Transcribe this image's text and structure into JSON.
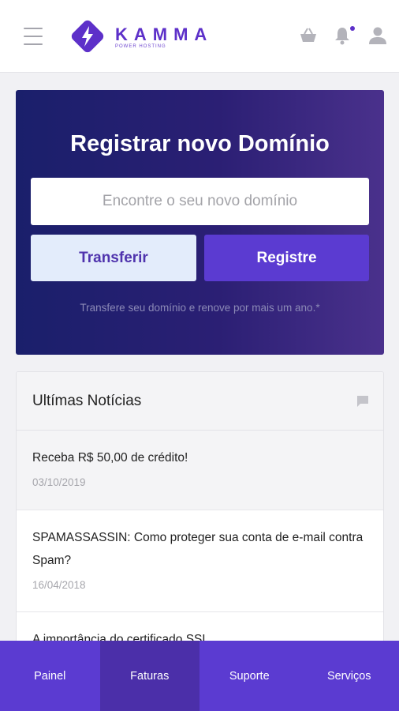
{
  "header": {
    "logo_text": "KAMMA",
    "logo_subtitle": "POWER HOSTING",
    "icons": [
      "menu-icon",
      "basket-icon",
      "bell-icon",
      "user-icon"
    ],
    "accent": "#5d30c9"
  },
  "hero": {
    "title": "Registrar novo Domínio",
    "search_placeholder": "Encontre o seu novo domínio",
    "transfer_label": "Transferir",
    "register_label": "Registre",
    "note": "Transfere seu domínio e renove por mais um ano.*"
  },
  "news": {
    "title": "Ultímas Notícias",
    "items": [
      {
        "title": "Receba R$ 50,00 de crédito!",
        "date": "03/10/2019"
      },
      {
        "title": "SPAMASSASSIN: Como proteger sua conta de e-mail contra Spam?",
        "date": "16/04/2018"
      },
      {
        "title": "A importância do certificado SSL",
        "date": ""
      }
    ]
  },
  "bottom_nav": {
    "items": [
      {
        "label": "Painel"
      },
      {
        "label": "Faturas"
      },
      {
        "label": "Suporte"
      },
      {
        "label": "Serviços"
      }
    ],
    "active": "Faturas"
  }
}
